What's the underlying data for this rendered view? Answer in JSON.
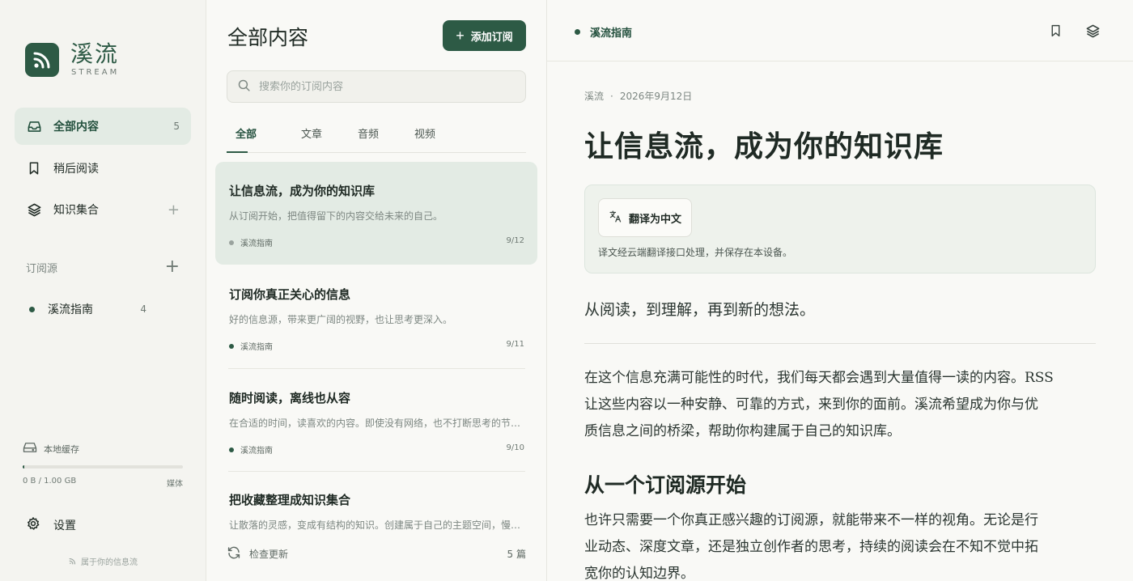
{
  "brand": {
    "name": "溪流",
    "subtitle": "STREAM"
  },
  "nav": [
    {
      "label": "全部内容",
      "count": "5"
    },
    {
      "label": "稍后阅读"
    },
    {
      "label": "知识集合",
      "add": "+"
    }
  ],
  "feeds_section": {
    "title": "订阅源",
    "add": "+"
  },
  "feeds": [
    {
      "label": "溪流指南",
      "count": "4"
    }
  ],
  "cache": {
    "label": "本地缓存",
    "usage": "0 B / 1.00 GB",
    "type": "媒体",
    "fill_percent": 1
  },
  "settings_label": "设置",
  "tagline": "属于你的信息流",
  "list": {
    "title": "全部内容",
    "add_button": "添加订阅",
    "search_placeholder": "搜索你的订阅内容",
    "tabs": [
      "全部",
      "文章",
      "音频",
      "视频"
    ],
    "items": [
      {
        "title": "让信息流，成为你的知识库",
        "summary": "从订阅开始，把值得留下的内容交给未来的自己。",
        "source": "溪流指南",
        "date": "9/12"
      },
      {
        "title": "订阅你真正关心的信息",
        "summary": "好的信息源，带来更广阔的视野，也让思考更深入。",
        "source": "溪流指南",
        "date": "9/11"
      },
      {
        "title": "随时阅读，离线也从容",
        "summary": "在合适的时间，读喜欢的内容。即使没有网络，也不打断思考的节奏。",
        "source": "溪流指南",
        "date": "9/10"
      },
      {
        "title": "把收藏整理成知识集合",
        "summary": "让散落的灵感，变成有结构的知识。创建属于自己的主题空间，慢慢积累。",
        "source": "",
        "date": ""
      }
    ],
    "footer_label": "检查更新",
    "footer_count": "5 篇"
  },
  "reader": {
    "source": "溪流指南",
    "meta_source": "溪流",
    "meta_sep": "·",
    "meta_date": "2026年9月12日",
    "title": "让信息流，成为你的知识库",
    "translate_button": "翻译为中文",
    "translate_note": "译文经云端翻译接口处理，并保存在本设备。",
    "lead": "从阅读，到理解，再到新的想法。",
    "para1_l1": "在这个信息充满可能性的时代，我们每天都会遇到大量值得一读的内容。RSS",
    "para1_l2": "让这些内容以一种安静、可靠的方式，来到你的面前。溪流希望成为你与优",
    "para1_l3": "质信息之间的桥梁，帮助你构建属于自己的知识库。",
    "h2": "从一个订阅源开始",
    "para2_l1": "也许只需要一个你真正感兴趣的订阅源，就能带来不一样的视角。无论是行",
    "para2_l2": "业动态、深度文章，还是独立创作者的思考，持续的阅读会在不知不觉中拓",
    "para2_l3": "宽你的认知边界。"
  },
  "colors": {
    "accent": "#2d5a45",
    "active_bg": "#e3ebe4"
  }
}
